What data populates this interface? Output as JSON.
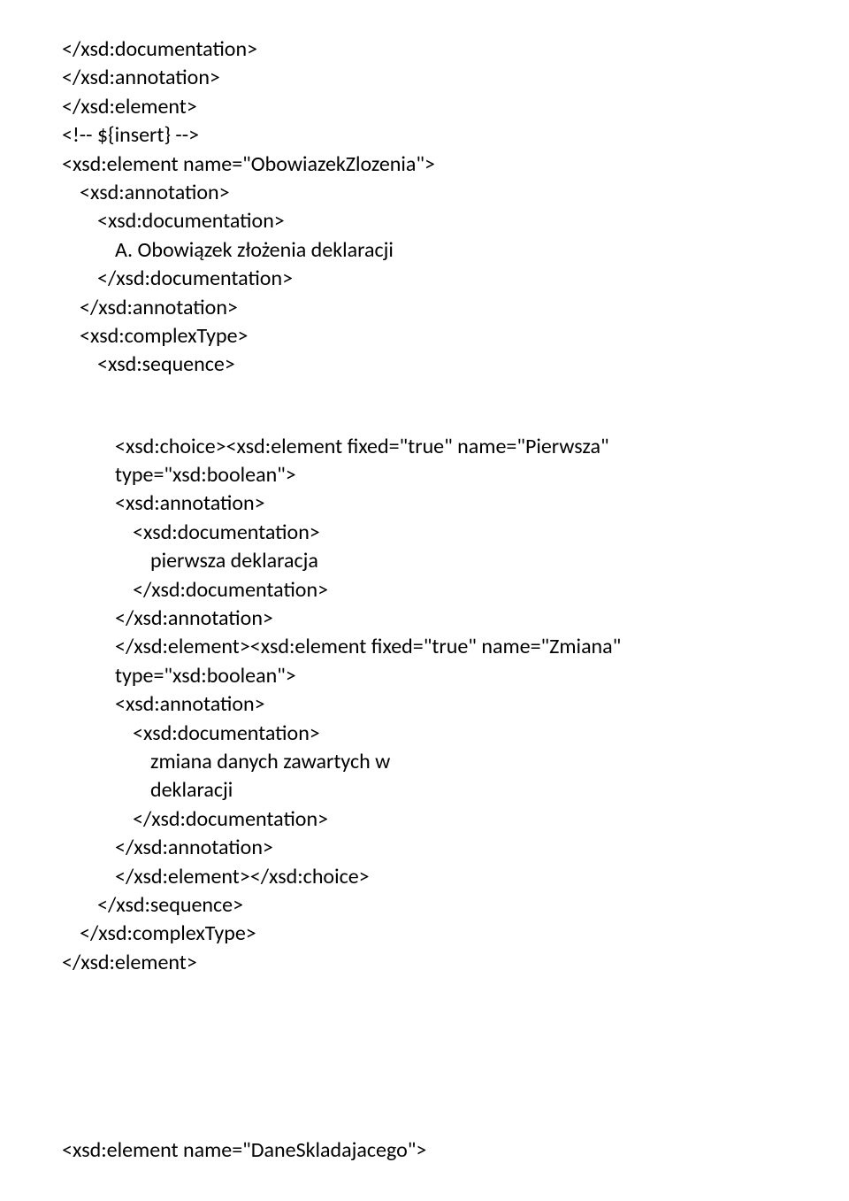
{
  "lines": [
    {
      "indent": 0,
      "text": "</xsd:documentation>"
    },
    {
      "indent": 0,
      "text": "</xsd:annotation>"
    },
    {
      "indent": 0,
      "text": "</xsd:element>"
    },
    {
      "indent": 0,
      "text": "<!-- ${insert} -->"
    },
    {
      "indent": 0,
      "text": "<xsd:element name=\"ObowiazekZlozenia\">"
    },
    {
      "indent": 1,
      "text": "<xsd:annotation>"
    },
    {
      "indent": 2,
      "text": "<xsd:documentation>"
    },
    {
      "indent": 3,
      "text": "A. Obowiązek złożenia deklaracji"
    },
    {
      "indent": 2,
      "text": "</xsd:documentation>"
    },
    {
      "indent": 1,
      "text": "</xsd:annotation>"
    },
    {
      "indent": 1,
      "text": "<xsd:complexType>"
    },
    {
      "indent": 2,
      "text": "<xsd:sequence>"
    }
  ],
  "lines2": [
    {
      "indent": 3,
      "text": "<xsd:choice><xsd:element fixed=\"true\" name=\"Pierwsza\" type=\"xsd:boolean\">"
    },
    {
      "indent": 3,
      "text": "<xsd:annotation>"
    },
    {
      "indent": 4,
      "text": "<xsd:documentation>"
    },
    {
      "indent": 5,
      "text": "pierwsza deklaracja"
    },
    {
      "indent": 4,
      "text": "</xsd:documentation>"
    },
    {
      "indent": 3,
      "text": "</xsd:annotation>"
    },
    {
      "indent": 3,
      "text": "</xsd:element><xsd:element fixed=\"true\" name=\"Zmiana\" type=\"xsd:boolean\">"
    },
    {
      "indent": 3,
      "text": "<xsd:annotation>"
    },
    {
      "indent": 4,
      "text": "<xsd:documentation>"
    },
    {
      "indent": 5,
      "text": "zmiana danych zawartych w"
    },
    {
      "indent": 5,
      "text": "deklaracji"
    },
    {
      "indent": 4,
      "text": "</xsd:documentation>"
    },
    {
      "indent": 3,
      "text": "</xsd:annotation>"
    },
    {
      "indent": 3,
      "text": "</xsd:element></xsd:choice>"
    },
    {
      "indent": 2,
      "text": "</xsd:sequence>"
    },
    {
      "indent": 1,
      "text": "</xsd:complexType>"
    },
    {
      "indent": 0,
      "text": "</xsd:element>"
    }
  ],
  "lines3": [
    {
      "indent": 0,
      "text": "<xsd:element name=\"DaneSkladajacego\">"
    }
  ]
}
